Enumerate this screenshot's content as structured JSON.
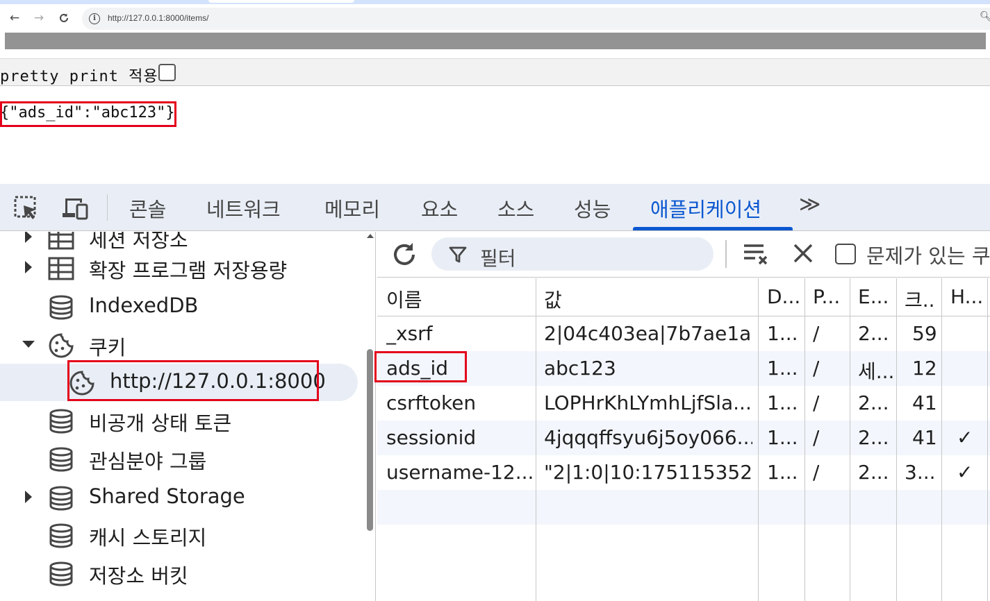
{
  "browser": {
    "back_icon": "arrow-left-icon",
    "forward_icon": "arrow-right-icon",
    "reload_icon": "reload-icon",
    "url": "http://127.0.0.1:8000/items/"
  },
  "page": {
    "pretty_print_label": "pretty print 적용",
    "pretty_print_checked": false,
    "json_body": "{\"ads_id\":\"abc123\"}"
  },
  "devtools": {
    "tabs": [
      {
        "label": "콘솔"
      },
      {
        "label": "네트워크"
      },
      {
        "label": "메모리"
      },
      {
        "label": "요소"
      },
      {
        "label": "소스"
      },
      {
        "label": "성능"
      },
      {
        "label": "애플리케이션",
        "active": true
      }
    ],
    "more_tabs": "≫",
    "accent_color": "#0b57d0",
    "sidebar": {
      "items": [
        {
          "label": "세션 저장소",
          "icon": "table-icon",
          "expander": "collapsed"
        },
        {
          "label": "확장 프로그램 저장용량",
          "icon": "table-icon",
          "expander": "collapsed"
        },
        {
          "label": "IndexedDB",
          "icon": "database-icon",
          "expander": "none"
        },
        {
          "label": "쿠키",
          "icon": "cookie-icon",
          "expander": "expanded"
        },
        {
          "label": "http://127.0.0.1:8000",
          "icon": "cookie-icon",
          "expander": "none",
          "selected": true
        },
        {
          "label": "비공개 상태 토큰",
          "icon": "database-icon",
          "expander": "none"
        },
        {
          "label": "관심분야 그룹",
          "icon": "database-icon",
          "expander": "none"
        },
        {
          "label": "Shared Storage",
          "icon": "database-icon",
          "expander": "collapsed"
        },
        {
          "label": "캐시 스토리지",
          "icon": "database-icon",
          "expander": "none"
        },
        {
          "label": "저장소 버킷",
          "icon": "database-icon",
          "expander": "none"
        }
      ]
    },
    "cookies": {
      "filter_placeholder": "필터",
      "only_issues_label": "문제가 있는 쿠",
      "columns": [
        "이름",
        "값",
        "D...",
        "P...",
        "E...",
        "크..",
        "H..."
      ],
      "rows": [
        {
          "name": "_xsrf",
          "value": "2|04c403ea|7b7ae1a...",
          "domain": "1...",
          "path": "/",
          "expires": "2...",
          "size": "59",
          "http": ""
        },
        {
          "name": "ads_id",
          "value": "abc123",
          "domain": "1...",
          "path": "/",
          "expires": "세...",
          "size": "12",
          "http": ""
        },
        {
          "name": "csrftoken",
          "value": "LOPHrKhLYmhLjfSla...",
          "domain": "1...",
          "path": "/",
          "expires": "2...",
          "size": "41",
          "http": ""
        },
        {
          "name": "sessionid",
          "value": "4jqqqffsyu6j5oy066...",
          "domain": "1...",
          "path": "/",
          "expires": "2...",
          "size": "41",
          "http": "✓"
        },
        {
          "name": "username-12...",
          "value": "\"2|1:0|10:175115352...",
          "domain": "1...",
          "path": "/",
          "expires": "2...",
          "size": "3...",
          "http": "✓"
        }
      ]
    }
  }
}
